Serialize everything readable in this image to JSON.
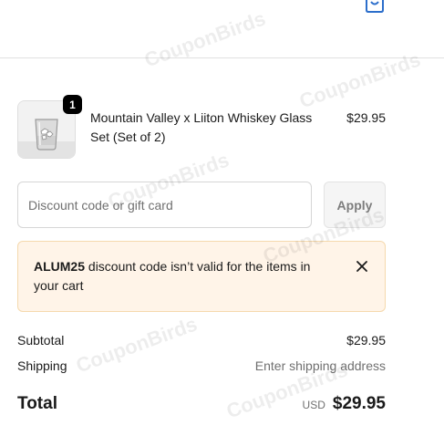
{
  "product": {
    "quantity": "1",
    "title": "Mountain Valley x Liiton Whiskey Glass Set (Set of 2)",
    "price": "$29.95"
  },
  "discount": {
    "placeholder": "Discount code or gift card",
    "value": "",
    "apply_label": "Apply"
  },
  "alert": {
    "code": "ALUM25",
    "message": " discount code isn’t valid for the items in your cart"
  },
  "summary": {
    "subtotal_label": "Subtotal",
    "subtotal_value": "$29.95",
    "shipping_label": "Shipping",
    "shipping_value": "Enter shipping address",
    "total_label": "Total",
    "currency": "USD",
    "total_value": "$29.95"
  },
  "watermark": "CouponBirds",
  "colors": {
    "alert_background": "#fff4e8",
    "alert_border": "#f5d9ad",
    "badge": "#000000"
  }
}
